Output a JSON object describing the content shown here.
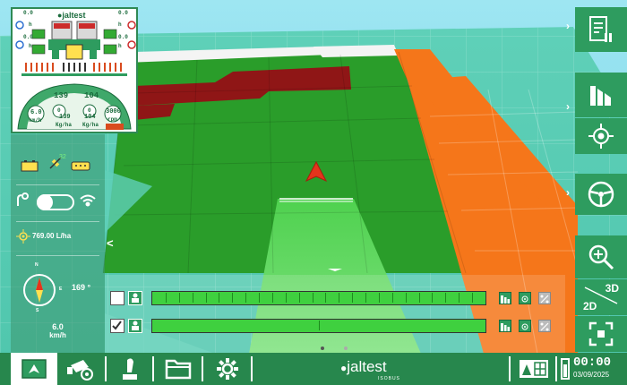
{
  "brand": {
    "name": "jaltest",
    "sub": "ISOBUS"
  },
  "clock": {
    "time": "00:00",
    "date": "03/09/2025"
  },
  "left_panel": {
    "satellites": "32",
    "rate": "769.00 L/ha",
    "heading": "169 °",
    "speed_value": "6.0",
    "speed_unit": "km/h",
    "compass_n": "N",
    "compass_s": "S",
    "compass_e": "E"
  },
  "monitor": {
    "top_left_value": "0.0",
    "top_left_unit": "h",
    "top_right_value": "0.0",
    "top_right_unit": "h",
    "mid_left_value": "0.0",
    "mid_left_unit": "h",
    "mid_right_value": "0.0",
    "mid_right_unit": "h",
    "gauge_left_top": "139",
    "gauge_right_top": "104",
    "gauge_speed": "6.0",
    "gauge_speed_unit": "km/h",
    "gauge_rate1": "139",
    "gauge_rate1_unit": "Kg/ha",
    "gauge_rate2": "104",
    "gauge_rate2_unit": "Kg/ha",
    "gauge_rpm": "3000",
    "gauge_rpm_unit": "rpm",
    "gauge_r_left": "0",
    "gauge_r_right": "0"
  },
  "right_bar": {
    "view_3d": "3D",
    "view_2d": "2D"
  },
  "colors": {
    "field_green": "#2a9d2a",
    "worked_orange": "#f5761a",
    "unworked_red": "#8f1616",
    "headland_cyan": "#2aa8a8",
    "brand_green": "#2e9c5f"
  },
  "icons": {
    "bottom": [
      "map-view-icon",
      "implement-icon",
      "joystick-icon",
      "folder-icon",
      "settings-icon",
      "grid-view-icon",
      "battery-icon"
    ],
    "right": [
      "document-pause-icon",
      "section-control-icon",
      "gps-center-icon",
      "steering-wheel-icon",
      "zoom-in-icon",
      "view-toggle-3d-icon",
      "fullscreen-icon"
    ]
  },
  "sections": {
    "row1_segments": 25,
    "row2_segments": 2
  }
}
